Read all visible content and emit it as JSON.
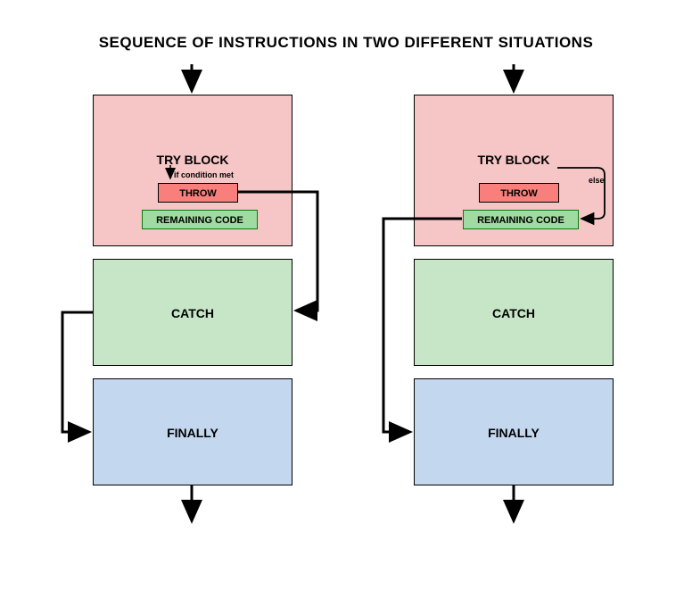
{
  "title": "SEQUENCE OF INSTRUCTIONS IN TWO DIFFERENT SITUATIONS",
  "left": {
    "try_label": "TRY BLOCK",
    "condition_label": "if condition met",
    "throw_label": "THROW",
    "remaining_label": "REMAINING CODE",
    "catch_label": "CATCH",
    "finally_label": "FINALLY"
  },
  "right": {
    "try_label": "TRY BLOCK",
    "else_label": "else",
    "throw_label": "THROW",
    "remaining_label": "REMAINING CODE",
    "catch_label": "CATCH",
    "finally_label": "FINALLY"
  }
}
